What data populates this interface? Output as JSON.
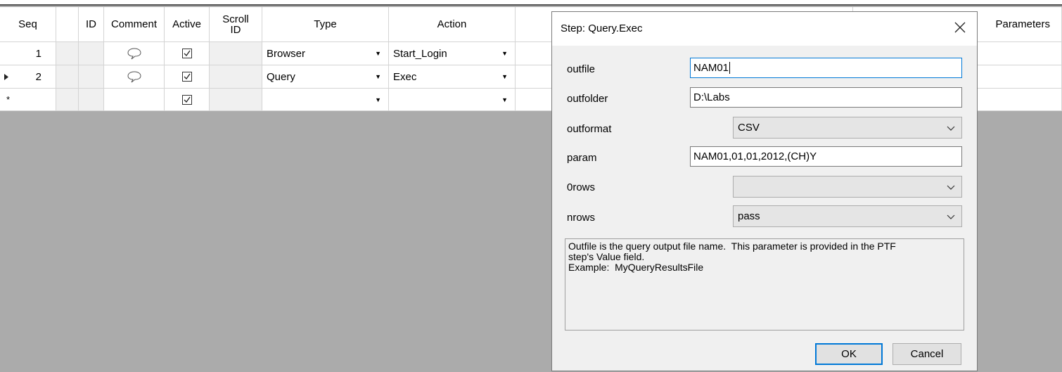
{
  "grid": {
    "headers": {
      "seq": "Seq",
      "id": "ID",
      "comment": "Comment",
      "active": "Active",
      "scroll_id": "Scroll\nID",
      "type": "Type",
      "action": "Action",
      "parameters": "Parameters"
    },
    "rows": [
      {
        "seq": "1",
        "type": "Browser",
        "action": "Start_Login",
        "active": true,
        "has_comment": true
      },
      {
        "seq": "2",
        "type": "Query",
        "action": "Exec",
        "active": true,
        "has_comment": true,
        "current": true
      },
      {
        "seq": "",
        "type": "",
        "action": "",
        "active": true,
        "has_comment": false,
        "new_row": true
      }
    ]
  },
  "dialog": {
    "title": "Step: Query.Exec",
    "fields": {
      "outfile": {
        "label": "outfile",
        "value": "NAM01"
      },
      "outfolder": {
        "label": "outfolder",
        "value": "D:\\Labs"
      },
      "outformat": {
        "label": "outformat",
        "value": "CSV"
      },
      "param": {
        "label": "param",
        "value": "NAM01,01,01,2012,(CH)Y"
      },
      "zerorows": {
        "label": "0rows",
        "value": ""
      },
      "nrows": {
        "label": "nrows",
        "value": "pass"
      }
    },
    "description": {
      "line1": "Outfile is the query output file name.  This parameter is provided in the PTF",
      "line2": "step's Value field.",
      "line3": "Example:  MyQueryResultsFile"
    },
    "ok_label": "OK",
    "cancel_label": "Cancel"
  },
  "icons": {
    "comment": "speech-bubble-icon",
    "check": "checkbox-checked-icon",
    "row_pointer": "triangle-right-icon",
    "new_row": "asterisk-icon",
    "dropdown": "dropdown-arrow-icon",
    "close": "close-x-icon"
  }
}
